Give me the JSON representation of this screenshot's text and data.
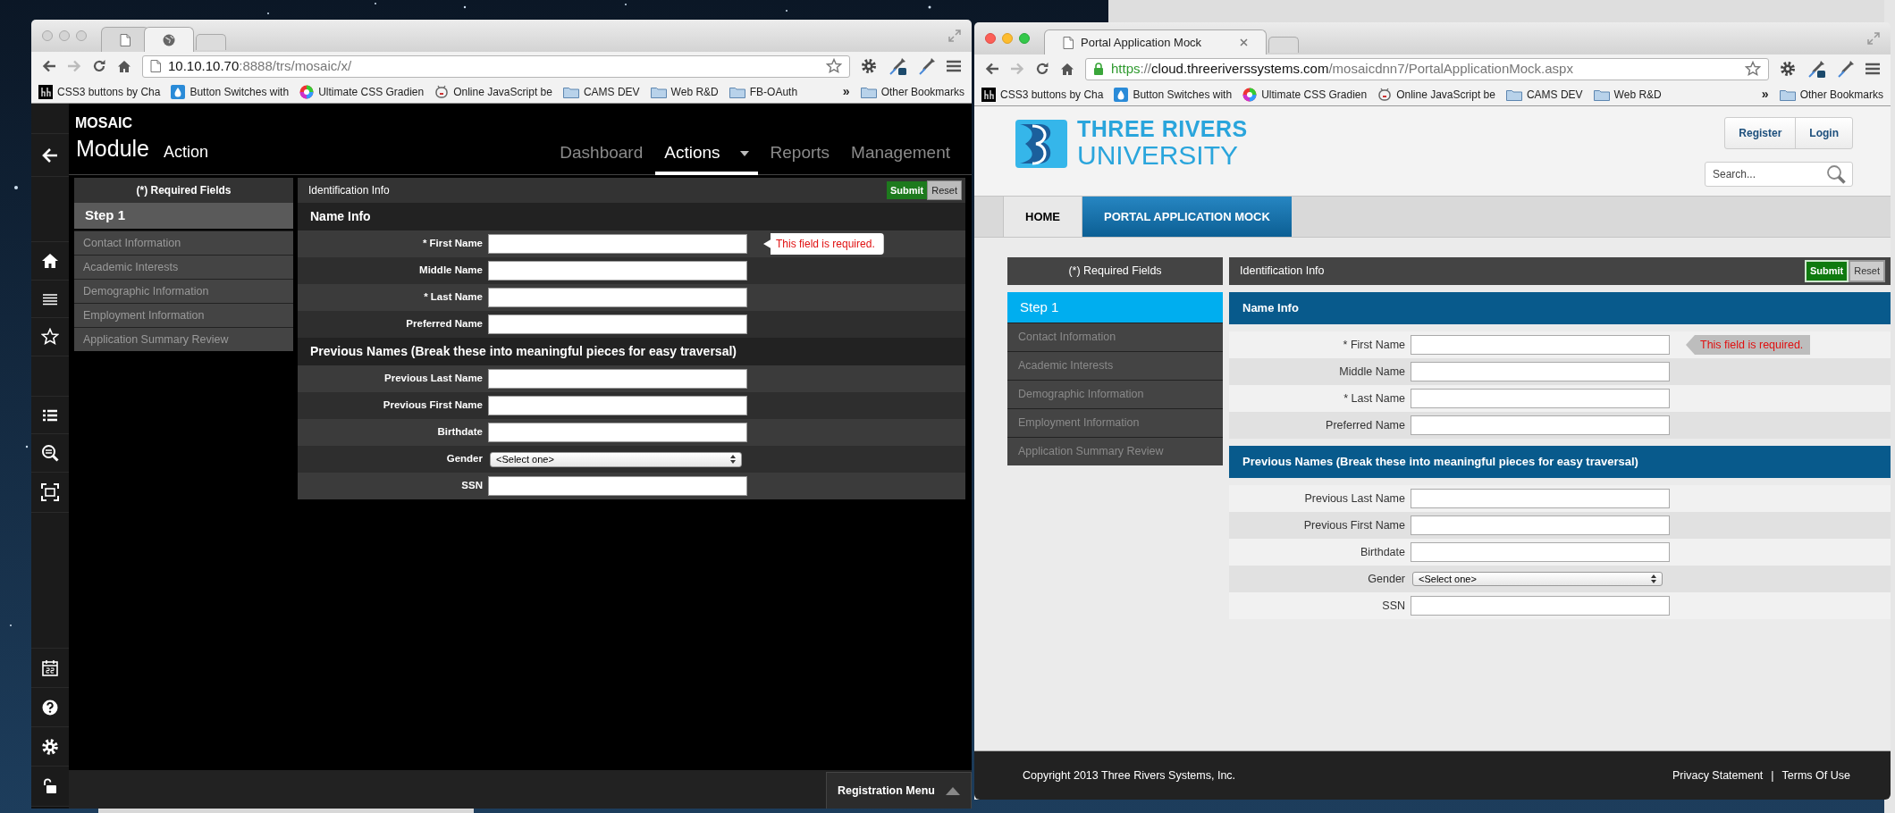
{
  "left_window": {
    "focused": false,
    "tabs": [
      {
        "selected": false
      },
      {
        "selected": true
      }
    ],
    "url": [
      {
        "text": "10.10.10.70",
        "color": "#111111"
      },
      {
        "text": ":8888/trs/mosaic/x/",
        "color": "#777777"
      }
    ],
    "bookmarks": [
      {
        "label": "CSS3 buttons by Cha",
        "kind": "site"
      },
      {
        "label": "Button Switches with",
        "kind": "site"
      },
      {
        "label": "Ultimate CSS Gradien",
        "kind": "site"
      },
      {
        "label": "Online JavaScript be",
        "kind": "site"
      },
      {
        "label": "CAMS DEV",
        "kind": "folder"
      },
      {
        "label": "Web R&D",
        "kind": "folder"
      },
      {
        "label": "FB-OAuth",
        "kind": "folder"
      }
    ],
    "bookmarks_overflow": "»",
    "other_bookmarks": "Other Bookmarks",
    "page": {
      "brand": "MOSAIC",
      "module": "Module",
      "action": "Action",
      "nav": [
        {
          "label": "Dashboard",
          "selected": false,
          "dropdown": false
        },
        {
          "label": "Actions",
          "selected": true,
          "dropdown": true
        },
        {
          "label": "Reports",
          "selected": false,
          "dropdown": false
        },
        {
          "label": "Management",
          "selected": false,
          "dropdown": false
        }
      ],
      "form": {
        "required_label": "(*) Required Fields",
        "steps": [
          {
            "label": "Step 1",
            "selected": true
          },
          {
            "label": "Contact Information",
            "selected": false
          },
          {
            "label": "Academic Interests",
            "selected": false
          },
          {
            "label": "Demographic Information",
            "selected": false
          },
          {
            "label": "Employment Information",
            "selected": false
          },
          {
            "label": "Application Summary Review",
            "selected": false
          }
        ],
        "header": "Identification Info",
        "submit": "Submit",
        "reset": "Reset",
        "sections": [
          {
            "title": "Name Info",
            "fields": [
              {
                "label": "* First Name",
                "kind": "text",
                "error": "This field is required."
              },
              {
                "label": "Middle Name",
                "kind": "text"
              },
              {
                "label": "* Last Name",
                "kind": "text"
              },
              {
                "label": "Preferred Name",
                "kind": "text"
              }
            ]
          },
          {
            "title": "Previous Names (Break these into meaningful pieces for easy traversal)",
            "fields": [
              {
                "label": "Previous Last Name",
                "kind": "text"
              },
              {
                "label": "Previous First Name",
                "kind": "text"
              },
              {
                "label": "Birthdate",
                "kind": "text"
              },
              {
                "label": "Gender",
                "kind": "select",
                "value": "<Select one>"
              },
              {
                "label": "SSN",
                "kind": "text"
              }
            ]
          }
        ]
      },
      "registration_menu": "Registration Menu"
    }
  },
  "right_window": {
    "focused": true,
    "tabs": [
      {
        "title": "Portal Application Mock",
        "selected": true
      }
    ],
    "secure": true,
    "url": [
      {
        "text": "https",
        "color": "#2f9a2f"
      },
      {
        "text": "://",
        "color": "#777777"
      },
      {
        "text": "cloud.threeriverssystems.com",
        "color": "#111111"
      },
      {
        "text": "/mosaicdnn7/PortalApplicationMock.aspx",
        "color": "#777777"
      }
    ],
    "bookmarks": [
      {
        "label": "CSS3 buttons by Cha",
        "kind": "site"
      },
      {
        "label": "Button Switches with",
        "kind": "site"
      },
      {
        "label": "Ultimate CSS Gradien",
        "kind": "site"
      },
      {
        "label": "Online JavaScript be",
        "kind": "site"
      },
      {
        "label": "CAMS DEV",
        "kind": "folder"
      },
      {
        "label": "Web R&D",
        "kind": "folder"
      }
    ],
    "bookmarks_overflow": "»",
    "other_bookmarks": "Other Bookmarks",
    "page": {
      "logo": [
        "THREE RIVERS",
        "UNIVERSITY"
      ],
      "account_buttons": [
        "Register",
        "Login"
      ],
      "search": {
        "placeholder": "Search..."
      },
      "nav": [
        {
          "label": "HOME",
          "selected": false
        },
        {
          "label": "PORTAL APPLICATION MOCK",
          "selected": true
        }
      ],
      "form": {
        "required_label": "(*) Required Fields",
        "steps": [
          {
            "label": "Step 1",
            "selected": true
          },
          {
            "label": "Contact Information",
            "selected": false
          },
          {
            "label": "Academic Interests",
            "selected": false
          },
          {
            "label": "Demographic Information",
            "selected": false
          },
          {
            "label": "Employment Information",
            "selected": false
          },
          {
            "label": "Application Summary Review",
            "selected": false
          }
        ],
        "header": "Identification Info",
        "submit": "Submit",
        "reset": "Reset",
        "sections": [
          {
            "title": "Name Info",
            "fields": [
              {
                "label": "* First Name",
                "kind": "text",
                "error": "This field is required."
              },
              {
                "label": "Middle Name",
                "kind": "text"
              },
              {
                "label": "* Last Name",
                "kind": "text"
              },
              {
                "label": "Preferred Name",
                "kind": "text"
              }
            ]
          },
          {
            "title": "Previous Names (Break these into meaningful pieces for easy traversal)",
            "fields": [
              {
                "label": "Previous Last Name",
                "kind": "text"
              },
              {
                "label": "Previous First Name",
                "kind": "text"
              },
              {
                "label": "Birthdate",
                "kind": "text"
              },
              {
                "label": "Gender",
                "kind": "select",
                "value": "<Select one>"
              },
              {
                "label": "SSN",
                "kind": "text"
              }
            ]
          }
        ]
      },
      "footer": {
        "copyright": "Copyright 2013 Three Rivers Systems, Inc.",
        "links": [
          "Privacy Statement",
          "Terms Of Use"
        ],
        "separator": "|"
      }
    }
  }
}
